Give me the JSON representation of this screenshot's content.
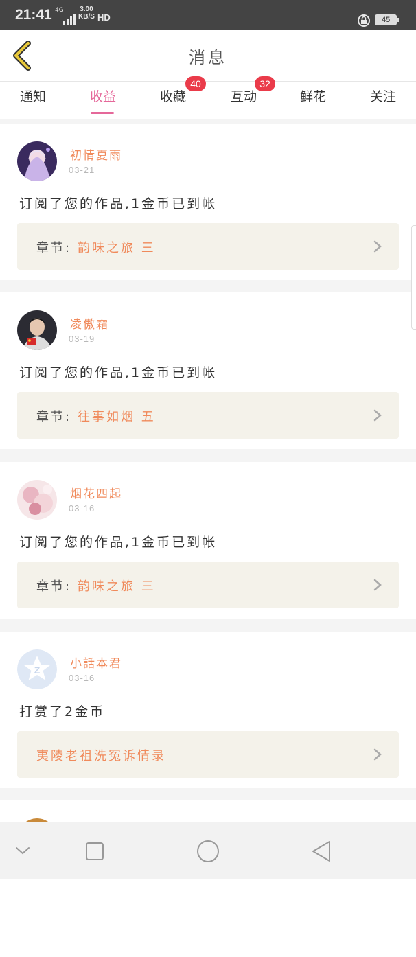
{
  "status_bar": {
    "time": "21:41",
    "network": "4G",
    "speed_value": "3.00",
    "speed_unit": "KB/S",
    "hd": "HD",
    "battery": "45"
  },
  "header": {
    "title": "消息"
  },
  "tabs": [
    {
      "label": "通知",
      "active": false
    },
    {
      "label": "收益",
      "active": true
    },
    {
      "label": "收藏",
      "active": false,
      "badge": "40"
    },
    {
      "label": "互动",
      "active": false,
      "badge": "32"
    },
    {
      "label": "鲜花",
      "active": false
    },
    {
      "label": "关注",
      "active": false
    }
  ],
  "messages": [
    {
      "name": "初情夏雨",
      "date": "03-21",
      "text": "订阅了您的作品,1金币已到帐",
      "chapter_label": "章节:",
      "chapter_value": "韵味之旅 三"
    },
    {
      "name": "凌傲霜",
      "date": "03-19",
      "text": "订阅了您的作品,1金币已到帐",
      "chapter_label": "章节:",
      "chapter_value": "往事如烟 五"
    },
    {
      "name": "烟花四起",
      "date": "03-16",
      "text": "订阅了您的作品,1金币已到帐",
      "chapter_label": "章节:",
      "chapter_value": "韵味之旅 三"
    },
    {
      "name": "小話本君",
      "date": "03-16",
      "text": "打赏了2金币",
      "chapter_label": "",
      "chapter_value": "夷陵老祖洗冤诉情录"
    }
  ],
  "colors": {
    "accent_pink": "#e5689a",
    "name_orange": "#f08a5b",
    "badge_red": "#ea3b4a",
    "back_yellow": "#e8c83a"
  }
}
